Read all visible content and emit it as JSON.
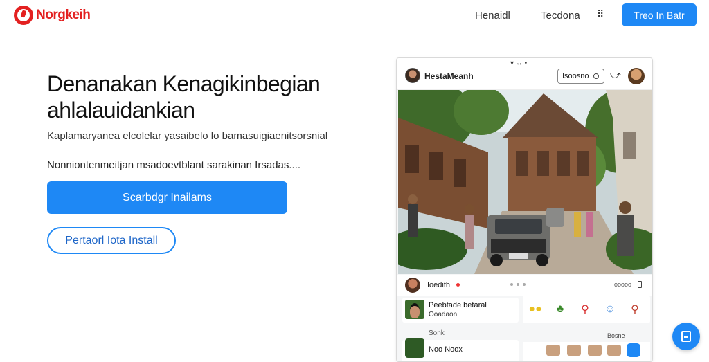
{
  "header": {
    "logo_text": "Norgkeih",
    "nav": [
      "Henaidl",
      "Tecdona"
    ],
    "more_icon": "grid-dots-icon",
    "cta_label": "Treo In Batr"
  },
  "hero": {
    "title": "Denanakan Kenagikinbegian ahlalauidankian",
    "subtitle": "Kaplamaryanea elcolelar yasaibelo lo bamasuigiaenitsorsnial",
    "description": "Nonniontenmeitjan msadoevtblant sarakinan Irsadas....",
    "primary_button": "Scarbdgr Inailams",
    "secondary_button": "Pertaorl Iota Install"
  },
  "mock": {
    "top_icons": "▾ ↔ •",
    "title": "HestaMeanh",
    "search_label": "Isoosno",
    "share_icon": "share-icon",
    "post_name": "Ioedith",
    "post_meta": "ooooo",
    "card1": {
      "title": "Peebtade betaral",
      "subtitle": "Ooadaon"
    },
    "section_label": "Sonk",
    "card2": {
      "title": "Noo Noox"
    },
    "right_label": "Bosne",
    "stickers": [
      "lemons-sticker",
      "plant-sticker",
      "drumstick-sticker",
      "character-sticker",
      "spoon-sticker"
    ]
  },
  "fab_icon": "document-icon",
  "colors": {
    "accent": "#1e88f5",
    "brand": "#e32020"
  }
}
